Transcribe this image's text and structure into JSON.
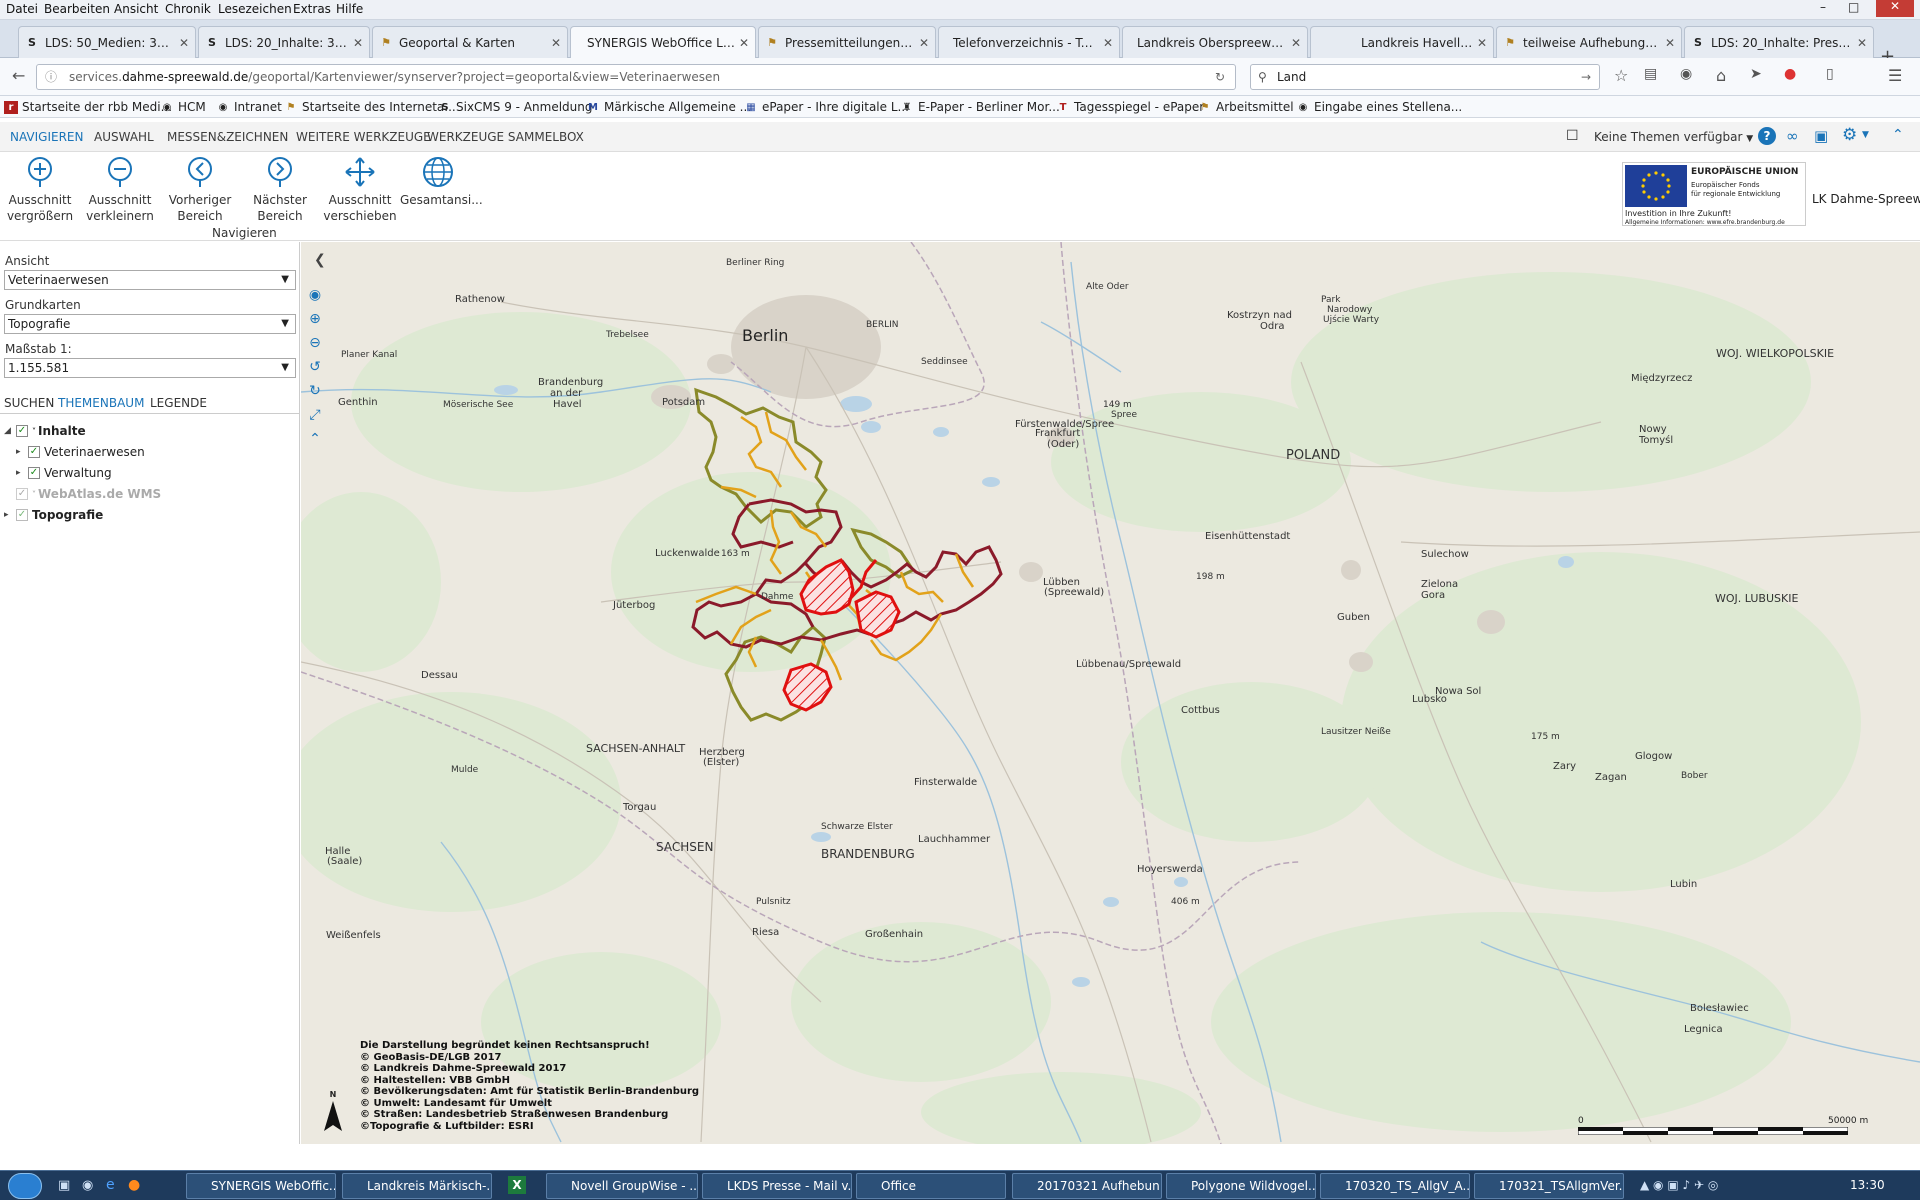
{
  "menu": [
    "Datei",
    "Bearbeiten",
    "Ansicht",
    "Chronik",
    "Lesezeichen",
    "Extras",
    "Hilfe"
  ],
  "tabs": [
    {
      "label": "LDS: 50_Medien: 30_Ei...",
      "icon": "S"
    },
    {
      "label": "LDS: 20_Inhalte: 32_Sei...",
      "icon": "S"
    },
    {
      "label": "Geoportal & Karten",
      "icon": "flag"
    },
    {
      "label": "SYNERGIS WebOffice LK D...",
      "icon": "none",
      "active": true
    },
    {
      "label": "Pressemitteilungen im...",
      "icon": "flag"
    },
    {
      "label": "Telefonverzeichnis - Telef...",
      "icon": "none"
    },
    {
      "label": "Landkreis Oberspreewald-...",
      "icon": "none"
    },
    {
      "label": "Landkreis Havelland - offiz...",
      "icon": "none"
    },
    {
      "label": "teilweise Aufhebung d...",
      "icon": "flag"
    },
    {
      "label": "LDS: 20_Inhalte: Presse...",
      "icon": "S"
    }
  ],
  "url": {
    "prefix": "services.",
    "domain": "dahme-spreewald.de",
    "path": "/geoportal/Kartenviewer/synserver?project=geoportal&view=Veterinaerwesen"
  },
  "search": {
    "value": "Land"
  },
  "bookmarks": [
    "Startseite der rbb Medi...",
    "HCM",
    "Intranet",
    "Startseite des Interneta...",
    "SixCMS 9 - Anmeldung",
    "Märkische Allgemeine ...",
    "ePaper - Ihre digitale L...",
    "E-Paper - Berliner Mor...",
    "Tagesspiegel - ePaper",
    "Arbeitsmittel",
    "Eingabe eines Stellena..."
  ],
  "app_tabs": [
    "NAVIGIEREN",
    "AUSWAHL",
    "MESSEN&ZEICHNEN",
    "WEITERE WERKZEUGE",
    "WERKZEUGE SAMMELBOX"
  ],
  "themes_label": "Keine Themen verfügbar",
  "ribbon": {
    "buttons": [
      {
        "l1": "Ausschnitt",
        "l2": "vergrößern"
      },
      {
        "l1": "Ausschnitt",
        "l2": "verkleinern"
      },
      {
        "l1": "Vorheriger",
        "l2": "Bereich"
      },
      {
        "l1": "Nächster",
        "l2": "Bereich"
      },
      {
        "l1": "Ausschnitt",
        "l2": "verschieben"
      },
      {
        "l1": "Gesamtansi...",
        "l2": ""
      }
    ],
    "group": "Navigieren"
  },
  "eu": {
    "title": "EUROPÄISCHE UNION",
    "fund1": "Europäischer Fonds",
    "fund2": "für regionale Entwicklung",
    "slogan": "Investition in Ihre Zukunft!",
    "info": "Allgemeine Informationen: www.efre.brandenburg.de"
  },
  "lds_label": "LK Dahme-Spreewald",
  "panel": {
    "ansicht_label": "Ansicht",
    "ansicht_value": "Veterinaerwesen",
    "grundkarten_label": "Grundkarten",
    "grundkarten_value": "Topografie",
    "massstab_label": "Maßstab 1:",
    "massstab_value": "1.155.581",
    "tabs": [
      "SUCHEN",
      "THEMENBAUM",
      "LEGENDE"
    ],
    "tree": {
      "inhalte": "Inhalte",
      "vet": "Veterinaerwesen",
      "verw": "Verwaltung",
      "webatlas": "WebAtlas.de WMS",
      "topo": "Topografie"
    }
  },
  "map_labels": [
    {
      "t": "Berlin",
      "big": true
    },
    {
      "t": "BERLIN"
    },
    {
      "t": "Berliner Ring"
    },
    {
      "t": "Rathenow"
    },
    {
      "t": "Genthin"
    },
    {
      "t": "Brandenburg"
    },
    {
      "t": "an der"
    },
    {
      "t": "Havel"
    },
    {
      "t": "Potsdam"
    },
    {
      "t": "Fürstenwalde/Spree"
    },
    {
      "t": "Frankfurt"
    },
    {
      "t": "(Oder)"
    },
    {
      "t": "Kostrzyn nad"
    },
    {
      "t": "Odra"
    },
    {
      "t": "Park"
    },
    {
      "t": "Narodowy"
    },
    {
      "t": "Ujście Warty"
    },
    {
      "t": "Międzyrzecz"
    },
    {
      "t": "Nowy"
    },
    {
      "t": "Tomyśl"
    },
    {
      "t": "Eisenhüttenstadt"
    },
    {
      "t": "Sulechow"
    },
    {
      "t": "Zielona"
    },
    {
      "t": "Gora"
    },
    {
      "t": "Guben"
    },
    {
      "t": "Luckenwalde"
    },
    {
      "t": "Jüterbog"
    },
    {
      "t": "Lübbenau/Spreewald"
    },
    {
      "t": "Cottbus"
    },
    {
      "t": "Lubsko"
    },
    {
      "t": "Nowa Sol"
    },
    {
      "t": "Dessau"
    },
    {
      "t": "SACHSEN-ANHALT"
    },
    {
      "t": "Herzberg"
    },
    {
      "t": "(Elster)"
    },
    {
      "t": "Finsterwalde"
    },
    {
      "t": "Torgau"
    },
    {
      "t": "Lauchhammer"
    },
    {
      "t": "Halle"
    },
    {
      "t": "(Saale)"
    },
    {
      "t": "BRANDENBURG"
    },
    {
      "t": "SACHSEN"
    },
    {
      "t": "Hoyerswerda"
    },
    {
      "t": "Zary"
    },
    {
      "t": "Zagan"
    },
    {
      "t": "Glogow"
    },
    {
      "t": "Lubin"
    },
    {
      "t": "Riesa"
    },
    {
      "t": "Großenhain"
    },
    {
      "t": "Bolesławiec"
    },
    {
      "t": "Legnica"
    },
    {
      "t": "POLAND"
    },
    {
      "t": "WOJ. LUBUSKIE"
    },
    {
      "t": "WOJ. WIELKOPOLSKIE"
    },
    {
      "t": "Lübben"
    },
    {
      "t": "(Spreewald)"
    },
    {
      "t": "Weißenfels"
    },
    {
      "t": "Planer Kanal"
    },
    {
      "t": "Möserische See"
    },
    {
      "t": "Trebelsee"
    },
    {
      "t": "Seddinsee"
    },
    {
      "t": "Alte Oder"
    },
    {
      "t": "Spree"
    },
    {
      "t": "Mulde"
    },
    {
      "t": "Schwarze Elster"
    },
    {
      "t": "Pulsnitz"
    },
    {
      "t": "Bober"
    },
    {
      "t": "Lausitzer Neiße"
    },
    {
      "t": "149 m"
    },
    {
      "t": "163 m"
    },
    {
      "t": "198 m"
    },
    {
      "t": "175 m"
    },
    {
      "t": "406 m"
    },
    {
      "t": "Dahme"
    }
  ],
  "attribution": [
    "Die Darstellung begründet keinen Rechtsanspruch!",
    "© GeoBasis-DE/LGB 2017",
    "© Landkreis Dahme-Spreewald 2017",
    "© Haltestellen: VBB GmbH",
    "© Bevölkerungsdaten: Amt für Statistik Berlin-Brandenburg",
    "© Umwelt: Landesamt für Umwelt",
    "© Straßen: Landesbetrieb Straßenwesen Brandenburg",
    "©Topografie & Luftbilder: ESRI"
  ],
  "scale": {
    "start": "0",
    "end": "50000 m"
  },
  "north": "N",
  "taskbar": [
    {
      "label": "SYNERGIS WebOffic..."
    },
    {
      "label": "Landkreis Märkisch-..."
    },
    {
      "label": "Novell GroupWise - ..."
    },
    {
      "label": "LKDS Presse - Mail v..."
    },
    {
      "label": "Office"
    },
    {
      "label": "20170321 Aufhebun..."
    },
    {
      "label": "Polygone Wildvogel..."
    },
    {
      "label": "170320_TS_AllgV_A..."
    },
    {
      "label": "170321_TSAllgmVer..."
    }
  ],
  "clock": "13:30",
  "colors": {
    "accent": "#1a74b8",
    "district_outer": "#8b1a2a",
    "district_olive": "#8a8a2a",
    "municipal": "#e2a21a",
    "restriction": "#e01010"
  }
}
